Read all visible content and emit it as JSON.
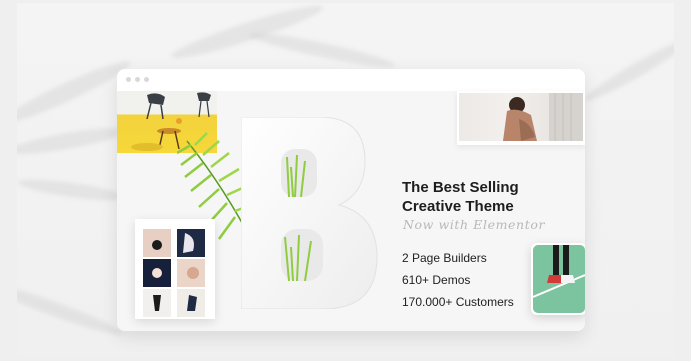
{
  "headline": {
    "line1": "The Best Selling",
    "line2": "Creative Theme",
    "script": "Now with Elementor"
  },
  "features": [
    "2 Page Builders",
    "610+ Demos",
    "170.000+ Customers"
  ],
  "logo_letter": "B",
  "colors": {
    "background": "#efefef",
    "window": "#f7f7f7",
    "text": "#1e1e1e",
    "script": "#b8b8b8",
    "yellow": "#f6d83a",
    "green": "#7cc3a0",
    "leaf": "#8fcc3f"
  }
}
